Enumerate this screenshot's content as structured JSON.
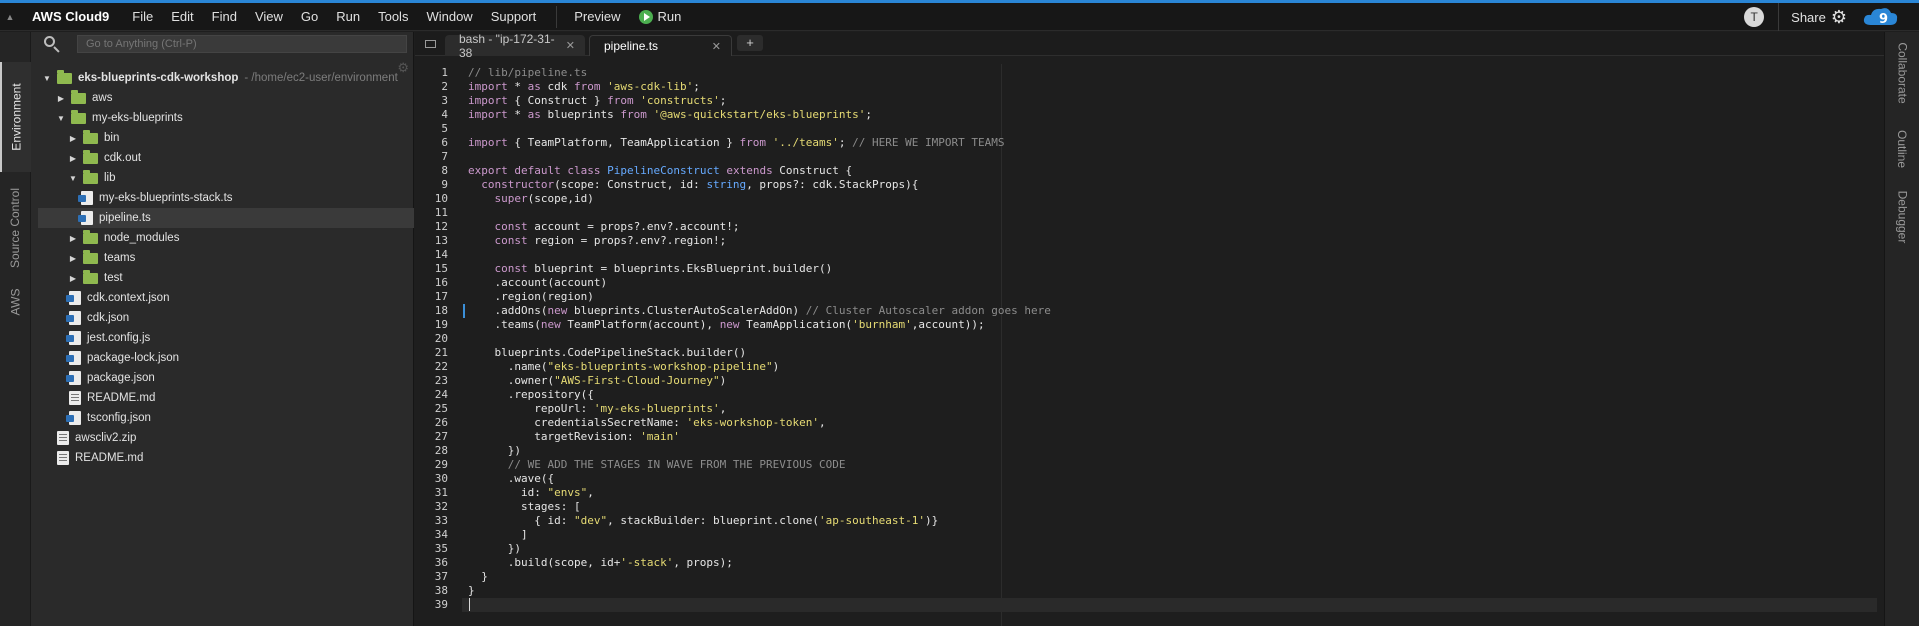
{
  "app": {
    "brand": "AWS Cloud9",
    "menu": [
      "File",
      "Edit",
      "Find",
      "View",
      "Go",
      "Run",
      "Tools",
      "Window",
      "Support"
    ],
    "preview_label": "Preview",
    "run_label": "Run",
    "avatar_initial": "T",
    "share_label": "Share"
  },
  "left_tabs": [
    "Environment",
    "Source Control",
    "AWS"
  ],
  "right_tabs": [
    "Collaborate",
    "Outline",
    "Debugger"
  ],
  "goto": {
    "placeholder": "Go to Anything (Ctrl-P)"
  },
  "tree": [
    {
      "kind": "folder",
      "open": true,
      "label": "eks-blueprints-cdk-workshop",
      "hint": "- /home/ec2-user/environment"
    },
    {
      "kind": "folder",
      "open": false,
      "label": "aws"
    },
    {
      "kind": "folder",
      "open": true,
      "label": "my-eks-blueprints"
    },
    {
      "kind": "folder",
      "open": false,
      "label": "bin"
    },
    {
      "kind": "folder",
      "open": false,
      "label": "cdk.out"
    },
    {
      "kind": "folder",
      "open": true,
      "label": "lib"
    },
    {
      "kind": "file",
      "type": "ts",
      "label": "my-eks-blueprints-stack.ts"
    },
    {
      "kind": "file",
      "type": "ts",
      "label": "pipeline.ts",
      "selected": true
    },
    {
      "kind": "folder",
      "open": false,
      "label": "node_modules"
    },
    {
      "kind": "folder",
      "open": false,
      "label": "teams"
    },
    {
      "kind": "folder",
      "open": false,
      "label": "test"
    },
    {
      "kind": "file",
      "type": "json",
      "label": "cdk.context.json"
    },
    {
      "kind": "file",
      "type": "json",
      "label": "cdk.json"
    },
    {
      "kind": "file",
      "type": "js",
      "label": "jest.config.js"
    },
    {
      "kind": "file",
      "type": "json",
      "label": "package-lock.json"
    },
    {
      "kind": "file",
      "type": "json",
      "label": "package.json"
    },
    {
      "kind": "file",
      "type": "md",
      "label": "README.md"
    },
    {
      "kind": "file",
      "type": "json",
      "label": "tsconfig.json"
    },
    {
      "kind": "file",
      "type": "zip",
      "label": "awscliv2.zip"
    },
    {
      "kind": "file",
      "type": "md",
      "label": "README.md"
    }
  ],
  "editor_tabs": [
    {
      "label": "bash - \"ip-172-31-38",
      "active": false
    },
    {
      "label": "pipeline.ts",
      "active": true
    }
  ],
  "add_tab_label": "+",
  "code_lines": [
    "// lib/pipeline.ts",
    "import * as cdk from 'aws-cdk-lib';",
    "import { Construct } from 'constructs';",
    "import * as blueprints from '@aws-quickstart/eks-blueprints';",
    "",
    "import { TeamPlatform, TeamApplication } from '../teams'; // HERE WE IMPORT TEAMS",
    "",
    "export default class PipelineConstruct extends Construct {",
    "  constructor(scope: Construct, id: string, props?: cdk.StackProps){",
    "    super(scope,id)",
    "",
    "    const account = props?.env?.account!;",
    "    const region = props?.env?.region!;",
    "",
    "    const blueprint = blueprints.EksBlueprint.builder()",
    "    .account(account)",
    "    .region(region)",
    "    .addOns(new blueprints.ClusterAutoScalerAddOn) // Cluster Autoscaler addon goes here",
    "    .teams(new TeamPlatform(account), new TeamApplication('burnham',account));",
    "",
    "    blueprints.CodePipelineStack.builder()",
    "      .name(\"eks-blueprints-workshop-pipeline\")",
    "      .owner(\"AWS-First-Cloud-Journey\")",
    "      .repository({",
    "          repoUrl: 'my-eks-blueprints',",
    "          credentialsSecretName: 'eks-workshop-token',",
    "          targetRevision: 'main'",
    "      })",
    "      // WE ADD THE STAGES IN WAVE FROM THE PREVIOUS CODE",
    "      .wave({",
    "        id: \"envs\",",
    "        stages: [",
    "          { id: \"dev\", stackBuilder: blueprint.clone('ap-southeast-1')}",
    "        ]",
    "      })",
    "      .build(scope, id+'-stack', props);",
    "  }",
    "}",
    ""
  ],
  "colors": {
    "keyword": "#cc99cd",
    "string": "#e6db74",
    "comment": "#8c8c8c",
    "type": "#66aaff",
    "accent": "#2a86d6",
    "folder": "#8fb94f"
  }
}
